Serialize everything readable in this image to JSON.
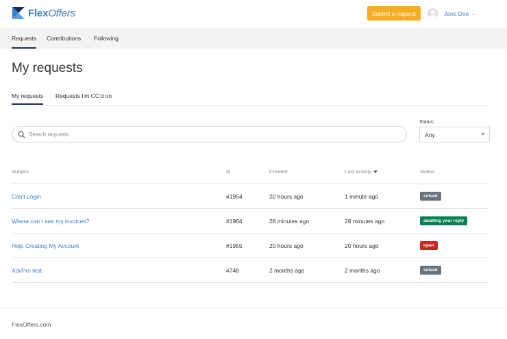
{
  "header": {
    "logo_bold": "Flex",
    "logo_italic": "Offers",
    "submit_label": "Submit a request",
    "user_name": "Jane Doe",
    "accent_color": "#f6ad23",
    "link_color": "#3a7fd0"
  },
  "nav": {
    "items": [
      {
        "label": "Requests",
        "active": true
      },
      {
        "label": "Contributions",
        "active": false
      },
      {
        "label": "Following",
        "active": false
      }
    ]
  },
  "page": {
    "title": "My requests"
  },
  "subtabs": {
    "items": [
      {
        "label": "My requests",
        "active": true
      },
      {
        "label": "Requests I'm CC'd on",
        "active": false
      }
    ]
  },
  "search": {
    "placeholder": "Search requests",
    "value": ""
  },
  "status_filter": {
    "label": "Status:",
    "value": "Any"
  },
  "table": {
    "columns": [
      "Subject",
      "Id",
      "Created",
      "Last activity",
      "Status"
    ],
    "sorted_by": "Last activity",
    "rows": [
      {
        "subject": "Can't Login",
        "id": "#1954",
        "created": "20 hours ago",
        "last_activity": "1 minute ago",
        "status": "solved",
        "status_color": "#68737d"
      },
      {
        "subject": "Where can I see my invoices?",
        "id": "#1964",
        "created": "28 minutes ago",
        "last_activity": "28 minutes ago",
        "status": "awaiting your reply",
        "status_color": "#038153"
      },
      {
        "subject": "Help Creating My Account",
        "id": "#1955",
        "created": "20 hours ago",
        "last_activity": "20 hours ago",
        "status": "open",
        "status_color": "#c72a1c"
      },
      {
        "subject": "AdvPro test",
        "id": "#748",
        "created": "2 months ago",
        "last_activity": "2 months ago",
        "status": "solved",
        "status_color": "#68737d"
      }
    ]
  },
  "footer": {
    "text": "FlexOffers.com"
  }
}
